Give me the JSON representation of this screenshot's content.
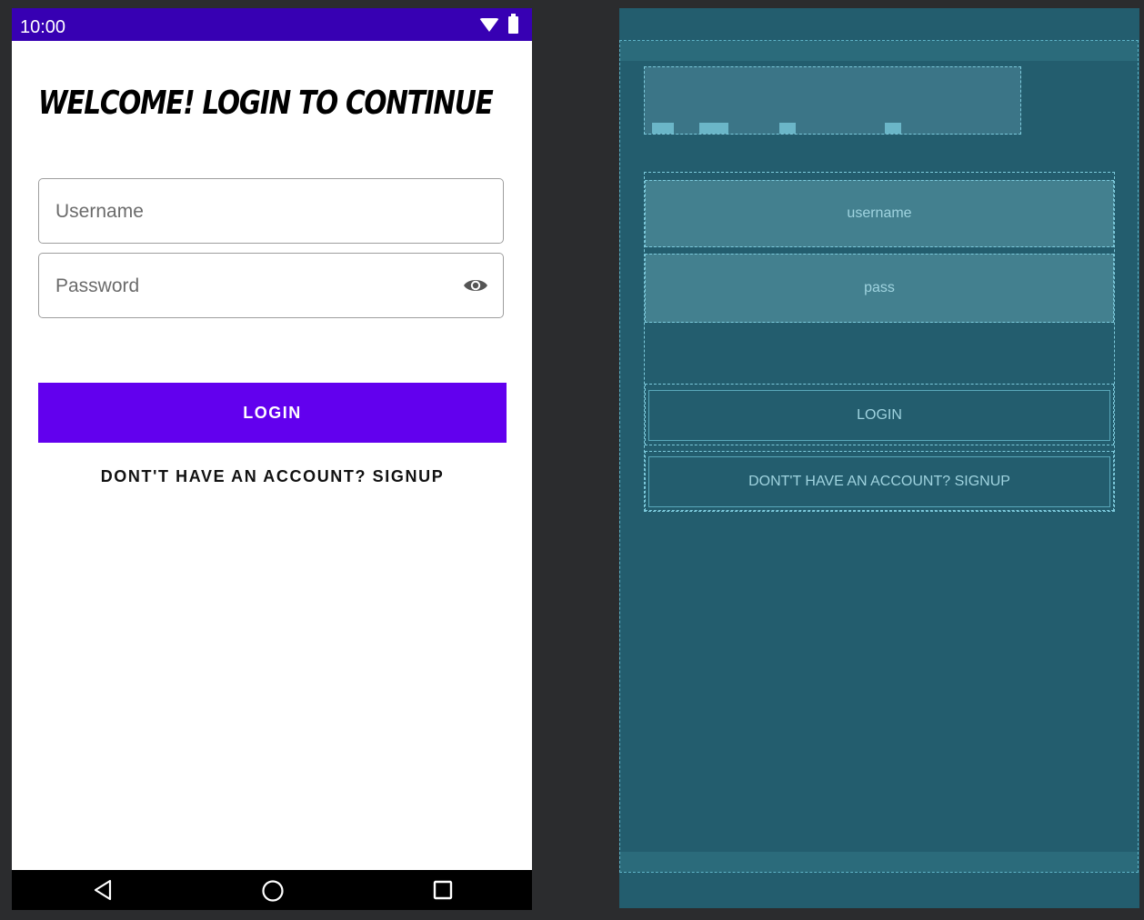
{
  "status_bar": {
    "time": "10:00"
  },
  "screen": {
    "title": "WELCOME! LOGIN TO CONTINUE",
    "username_placeholder": "Username",
    "password_placeholder": "Password",
    "login_label": "LOGIN",
    "signup_label": "DONT'T HAVE AN ACCOUNT? SIGNUP"
  },
  "blueprint": {
    "username_label": "username",
    "password_label": "pass",
    "login_label": "LOGIN",
    "signup_label": "DONT'T HAVE AN ACCOUNT? SIGNUP"
  },
  "colors": {
    "status_bar": "#3700b3",
    "primary_button": "#6200ee",
    "blueprint_bg": "#235d6e"
  },
  "icons": [
    "wifi-icon",
    "battery-icon",
    "eye-icon",
    "nav-back-icon",
    "nav-home-icon",
    "nav-recent-icon"
  ]
}
